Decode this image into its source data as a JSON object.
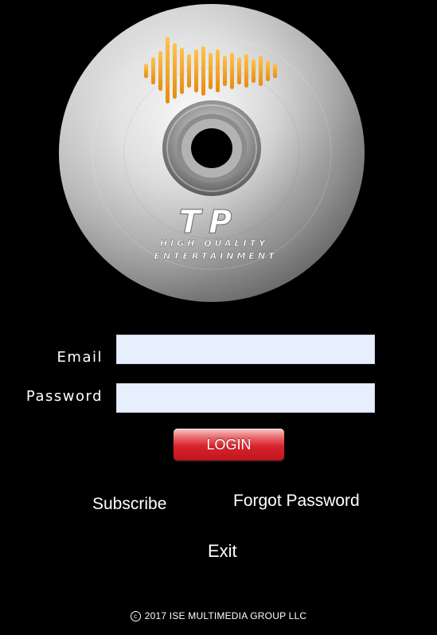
{
  "logo": {
    "monogram": "TP",
    "tagline_line1": "HIGH QUALITY",
    "tagline_line2": "ENTERTAINMENT",
    "accent_color": "#f5a623"
  },
  "login_form": {
    "email_label": "Email",
    "email_value": "",
    "password_label": "Password",
    "password_value": "",
    "login_button_label": "LOGIN",
    "login_button_color": "#d8232c"
  },
  "links": {
    "subscribe": "Subscribe",
    "forgot_password": "Forgot Password",
    "exit": "Exit"
  },
  "footer": {
    "copyright_symbol": "c",
    "copyright_text": "2017 ISE MULTIMEDIA GROUP LLC"
  }
}
